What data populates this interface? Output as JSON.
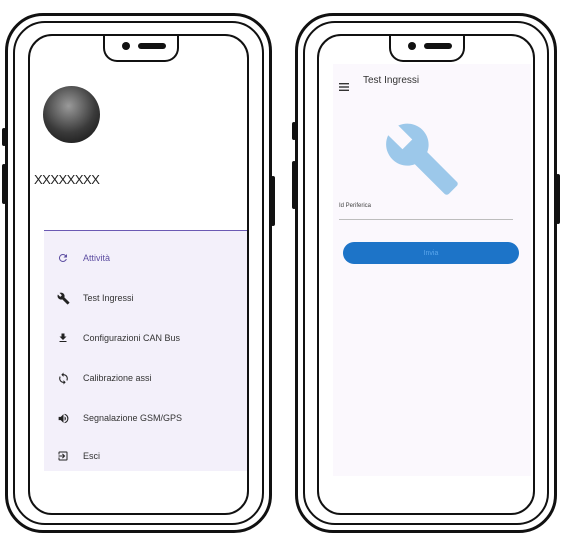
{
  "left_phone": {
    "user": {
      "name": "XXXXXXXX"
    },
    "drawer": {
      "items": [
        {
          "label": "Attività",
          "icon": "refresh-icon",
          "active": true
        },
        {
          "label": "Test Ingressi",
          "icon": "wrench-icon",
          "active": false
        },
        {
          "label": "Configurazioni CAN Bus",
          "icon": "download-icon",
          "active": false
        },
        {
          "label": "Calibrazione assi",
          "icon": "sync-icon",
          "active": false
        },
        {
          "label": "Segnalazione GSM/GPS",
          "icon": "volume-icon",
          "active": false
        },
        {
          "label": "Esci",
          "icon": "exit-icon",
          "active": false
        }
      ]
    }
  },
  "right_phone": {
    "appbar": {
      "title": "Test Ingressi",
      "menu_icon": "hamburger-menu-icon"
    },
    "hero_icon": "wrench-icon",
    "field": {
      "label": "Id Periferica",
      "value": ""
    },
    "button": {
      "label": "Invia"
    }
  },
  "colors": {
    "accent": "#5e4fa2",
    "drawer_background": "#f3f0fa",
    "button": "#1d74c8",
    "wrench": "#9cc8ea"
  }
}
